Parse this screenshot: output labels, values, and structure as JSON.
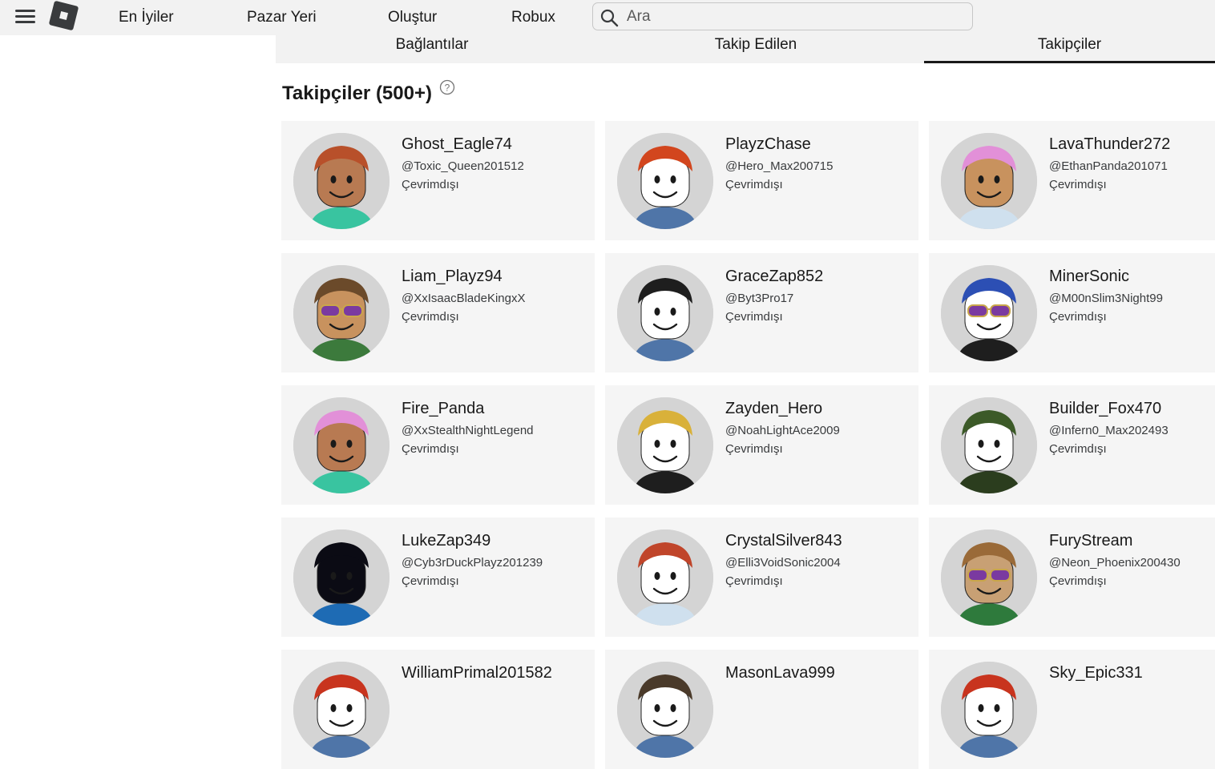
{
  "topbar": {
    "nav": [
      "En İyiler",
      "Pazar Yeri",
      "Oluştur",
      "Robux"
    ],
    "search_placeholder": "Ara"
  },
  "tabs": [
    {
      "label": "Bağlantılar",
      "active": false
    },
    {
      "label": "Takip Edilen",
      "active": false
    },
    {
      "label": "Takipçiler",
      "active": true
    }
  ],
  "section": {
    "title": "Takipçiler (500+)"
  },
  "followers": [
    {
      "display": "Ghost_Eagle74",
      "username": "@Toxic_Queen201512",
      "status": "Çevrimdışı",
      "hair": "#b8502a",
      "skin": "#b87a52",
      "shirt": "#39c4a0",
      "glasses": false
    },
    {
      "display": "PlayzChase",
      "username": "@Hero_Max200715",
      "status": "Çevrimdışı",
      "hair": "#d2461e",
      "skin": "#ffffff",
      "shirt": "#4f75a8",
      "glasses": false
    },
    {
      "display": "LavaThunder272",
      "username": "@EthanPanda201071",
      "status": "Çevrimdışı",
      "hair": "#e290d8",
      "skin": "#c8925e",
      "shirt": "#cfe0ee",
      "glasses": false
    },
    {
      "display": "Liam_Playz94",
      "username": "@XxIsaacBladeKingxX",
      "status": "Çevrimdışı",
      "hair": "#6b4a2a",
      "skin": "#c8925e",
      "shirt": "#3c7a3c",
      "glasses": true
    },
    {
      "display": "GraceZap852",
      "username": "@Byt3Pro17",
      "status": "Çevrimdışı",
      "hair": "#1e1e1e",
      "skin": "#ffffff",
      "shirt": "#4f75a8",
      "glasses": false
    },
    {
      "display": "MinerSonic",
      "username": "@M00nSlim3Night99",
      "status": "Çevrimdışı",
      "hair": "#2c4fb4",
      "skin": "#ffffff",
      "shirt": "#1e1e1e",
      "glasses": true
    },
    {
      "display": "Fire_Panda",
      "username": "@XxStealthNightLegend",
      "status": "Çevrimdışı",
      "hair": "#e290d8",
      "skin": "#b87a52",
      "shirt": "#39c4a0",
      "glasses": false
    },
    {
      "display": "Zayden_Hero",
      "username": "@NoahLightAce2009",
      "status": "Çevrimdışı",
      "hair": "#d9b13a",
      "skin": "#ffffff",
      "shirt": "#1e1e1e",
      "glasses": false
    },
    {
      "display": "Builder_Fox470",
      "username": "@Infern0_Max202493",
      "status": "Çevrimdışı",
      "hair": "#3c5a28",
      "skin": "#ffffff",
      "shirt": "#2b3d1e",
      "glasses": false
    },
    {
      "display": "LukeZap349",
      "username": "@Cyb3rDuckPlayz201239",
      "status": "Çevrimdışı",
      "hair": "#0b0b14",
      "skin": "#0b0b14",
      "shirt": "#1e6bb4",
      "glasses": false
    },
    {
      "display": "CrystalSilver843",
      "username": "@Elli3VoidSonic2004",
      "status": "Çevrimdışı",
      "hair": "#c0452a",
      "skin": "#ffffff",
      "shirt": "#cfe0ee",
      "glasses": false
    },
    {
      "display": "FuryStream",
      "username": "@Neon_Phoenix200430",
      "status": "Çevrimdışı",
      "hair": "#9a6a38",
      "skin": "#c8a074",
      "shirt": "#2e7a3c",
      "glasses": true
    },
    {
      "display": "WilliamPrimal201582",
      "username": "",
      "status": "",
      "hair": "#c8341e",
      "skin": "#ffffff",
      "shirt": "#4f75a8",
      "glasses": false
    },
    {
      "display": "MasonLava999",
      "username": "",
      "status": "",
      "hair": "#4a3a2a",
      "skin": "#ffffff",
      "shirt": "#4f75a8",
      "glasses": false
    },
    {
      "display": "Sky_Epic331",
      "username": "",
      "status": "",
      "hair": "#c8341e",
      "skin": "#ffffff",
      "shirt": "#4f75a8",
      "glasses": false
    }
  ]
}
